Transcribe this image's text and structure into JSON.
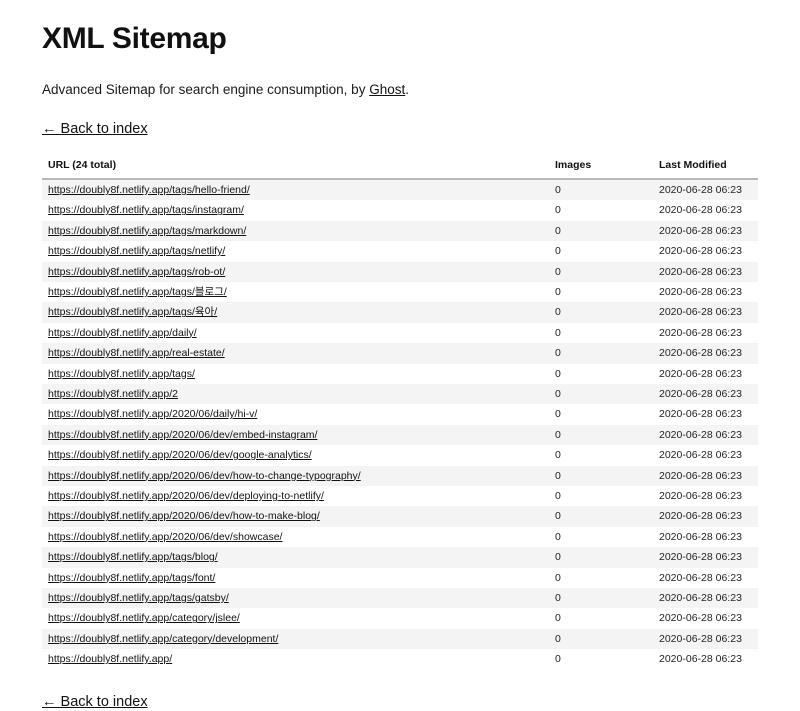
{
  "header": {
    "title": "XML Sitemap",
    "intro_prefix": "Advanced Sitemap for search engine consumption, by ",
    "intro_link": "Ghost",
    "intro_suffix": ".",
    "back_link": "← Back to index",
    "back_link_bottom": "← Back to index"
  },
  "table": {
    "columns": {
      "url": "URL (24 total)",
      "images": "Images",
      "modified": "Last Modified"
    },
    "rows": [
      {
        "url": "https://doubly8f.netlify.app/tags/hello-friend/",
        "images": "0",
        "modified": "2020-06-28 06:23"
      },
      {
        "url": "https://doubly8f.netlify.app/tags/instagram/",
        "images": "0",
        "modified": "2020-06-28 06:23"
      },
      {
        "url": "https://doubly8f.netlify.app/tags/markdown/",
        "images": "0",
        "modified": "2020-06-28 06:23"
      },
      {
        "url": "https://doubly8f.netlify.app/tags/netlify/",
        "images": "0",
        "modified": "2020-06-28 06:23"
      },
      {
        "url": "https://doubly8f.netlify.app/tags/rob-ot/",
        "images": "0",
        "modified": "2020-06-28 06:23"
      },
      {
        "url": "https://doubly8f.netlify.app/tags/블로그/",
        "images": "0",
        "modified": "2020-06-28 06:23"
      },
      {
        "url": "https://doubly8f.netlify.app/tags/육아/",
        "images": "0",
        "modified": "2020-06-28 06:23"
      },
      {
        "url": "https://doubly8f.netlify.app/daily/",
        "images": "0",
        "modified": "2020-06-28 06:23"
      },
      {
        "url": "https://doubly8f.netlify.app/real-estate/",
        "images": "0",
        "modified": "2020-06-28 06:23"
      },
      {
        "url": "https://doubly8f.netlify.app/tags/",
        "images": "0",
        "modified": "2020-06-28 06:23"
      },
      {
        "url": "https://doubly8f.netlify.app/2",
        "images": "0",
        "modified": "2020-06-28 06:23"
      },
      {
        "url": "https://doubly8f.netlify.app/2020/06/daily/hi-v/",
        "images": "0",
        "modified": "2020-06-28 06:23"
      },
      {
        "url": "https://doubly8f.netlify.app/2020/06/dev/embed-instagram/",
        "images": "0",
        "modified": "2020-06-28 06:23"
      },
      {
        "url": "https://doubly8f.netlify.app/2020/06/dev/google-analytics/",
        "images": "0",
        "modified": "2020-06-28 06:23"
      },
      {
        "url": "https://doubly8f.netlify.app/2020/06/dev/how-to-change-typography/",
        "images": "0",
        "modified": "2020-06-28 06:23"
      },
      {
        "url": "https://doubly8f.netlify.app/2020/06/dev/deploying-to-netlify/",
        "images": "0",
        "modified": "2020-06-28 06:23"
      },
      {
        "url": "https://doubly8f.netlify.app/2020/06/dev/how-to-make-blog/",
        "images": "0",
        "modified": "2020-06-28 06:23"
      },
      {
        "url": "https://doubly8f.netlify.app/2020/06/dev/showcase/",
        "images": "0",
        "modified": "2020-06-28 06:23"
      },
      {
        "url": "https://doubly8f.netlify.app/tags/blog/",
        "images": "0",
        "modified": "2020-06-28 06:23"
      },
      {
        "url": "https://doubly8f.netlify.app/tags/font/",
        "images": "0",
        "modified": "2020-06-28 06:23"
      },
      {
        "url": "https://doubly8f.netlify.app/tags/gatsby/",
        "images": "0",
        "modified": "2020-06-28 06:23"
      },
      {
        "url": "https://doubly8f.netlify.app/category/jslee/",
        "images": "0",
        "modified": "2020-06-28 06:23"
      },
      {
        "url": "https://doubly8f.netlify.app/category/development/",
        "images": "0",
        "modified": "2020-06-28 06:23"
      },
      {
        "url": "https://doubly8f.netlify.app/",
        "images": "0",
        "modified": "2020-06-28 06:23"
      }
    ]
  }
}
